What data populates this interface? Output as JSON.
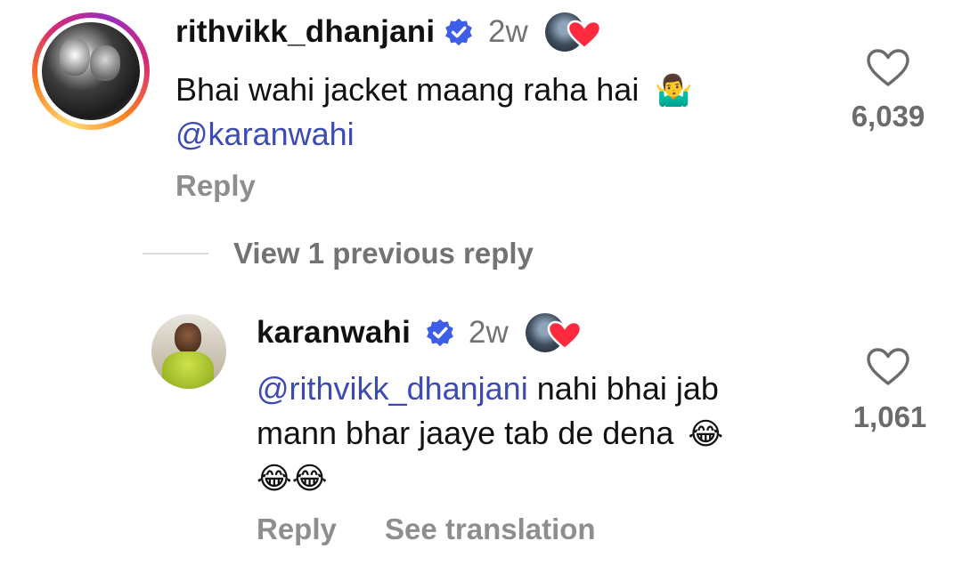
{
  "comments": [
    {
      "username": "rithvikk_dhanjani",
      "time": "2w",
      "text": "Bhai wahi jacket maang raha hai",
      "emoji": "🤷‍♂️",
      "mention": "@karanwahi",
      "reply_label": "Reply",
      "likes": "6,039"
    }
  ],
  "view_previous": "View 1 previous reply",
  "replies": [
    {
      "username": "karanwahi",
      "time": "2w",
      "mention": "@rithvikk_dhanjani",
      "text_line1": " nahi bhai jab",
      "text_line2": "mann bhar jaaye tab de dena",
      "emoji_trailing": "😂",
      "emoji_line3": "😂😂",
      "reply_label": "Reply",
      "see_translation": "See translation",
      "likes": "1,061"
    }
  ],
  "colors": {
    "mention": "#3c4bb3",
    "verified": "#3f5ee8",
    "muted": "#8e8e8e",
    "heart_red": "#ff2a3d"
  },
  "icons": {
    "verified": "verified-badge-icon",
    "like": "heart-outline-icon",
    "creator_like": "heart-filled-icon"
  }
}
